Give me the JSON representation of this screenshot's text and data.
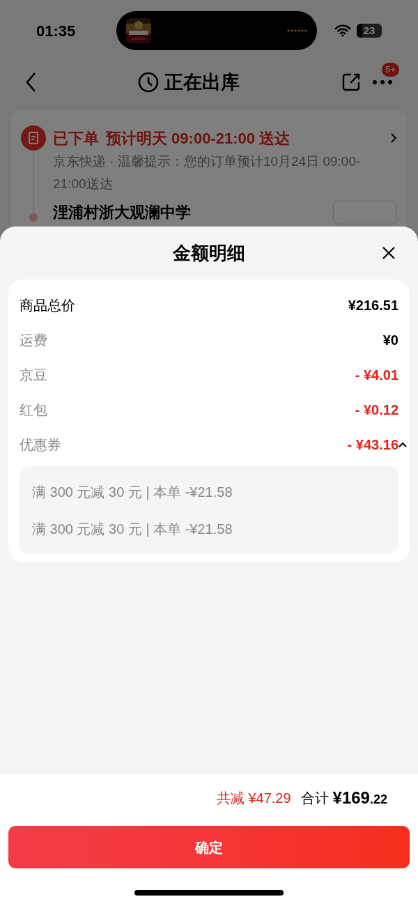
{
  "status_bar": {
    "time": "01:35",
    "battery": "23"
  },
  "header": {
    "title": "正在出库",
    "badge": "5+"
  },
  "order": {
    "status": "已下单",
    "estimate": "预计明天 09:00-21:00 送达",
    "note": "京东快递 · 温馨提示：您的订单预计10月24日 09:00-21:00送达",
    "address": "浬浦村浙大观澜中学"
  },
  "sheet": {
    "title": "金额明细",
    "rows": [
      {
        "kind": "total",
        "label": "商品总价",
        "amount": "¥216.51"
      },
      {
        "kind": "fee",
        "label": "运费",
        "amount": "¥0"
      },
      {
        "kind": "discount",
        "label": "京豆",
        "amount": "- ¥4.01"
      },
      {
        "kind": "discount",
        "label": "红包",
        "amount": "- ¥0.12"
      },
      {
        "kind": "discount",
        "label": "优惠券",
        "amount": "- ¥43.16",
        "expanded": true,
        "details": [
          "满 300 元减 30 元 | 本单 -¥21.58",
          "满 300 元减 30 元 | 本单 -¥21.58"
        ]
      }
    ]
  },
  "summary": {
    "reduced": "共减 ¥47.29",
    "total_label": "合计",
    "total": "¥169.22"
  },
  "confirm_button": "确定"
}
